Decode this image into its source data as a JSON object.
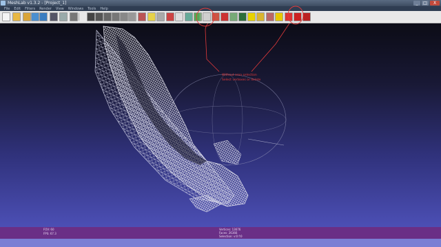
{
  "window": {
    "title": "MeshLab v1.3.2 - [Project_1]",
    "minimize_label": "_",
    "maximize_label": "□",
    "close_label": "X"
  },
  "menu": {
    "items": [
      "File",
      "Edit",
      "Filters",
      "Render",
      "View",
      "Windows",
      "Tools",
      "Help"
    ]
  },
  "toolbar": {
    "buttons": [
      {
        "icon": "new-file-icon",
        "color": "#f4f4f4"
      },
      {
        "icon": "open-folder-icon",
        "color": "#e8b844"
      },
      {
        "icon": "open-project-icon",
        "color": "#d9a53a"
      },
      {
        "icon": "reload-icon",
        "color": "#4a8fd0"
      },
      {
        "icon": "import-mesh-icon",
        "color": "#3a7dc0"
      },
      {
        "icon": "snapshot-icon",
        "color": "#556"
      },
      {
        "icon": "copy-icon",
        "color": "#9aa"
      },
      {
        "icon": "bounding-box-icon",
        "color": "#777"
      },
      {
        "icon": "points-icon",
        "color": "#444"
      },
      {
        "icon": "wireframe-icon",
        "color": "#555"
      },
      {
        "icon": "hidden-lines-icon",
        "color": "#666"
      },
      {
        "icon": "flat-lines-icon",
        "color": "#777"
      },
      {
        "icon": "flat-icon",
        "color": "#888"
      },
      {
        "icon": "smooth-icon",
        "color": "#999"
      },
      {
        "icon": "texture-icon",
        "color": "#b55"
      },
      {
        "icon": "light-icon",
        "color": "#e6d24a"
      },
      {
        "icon": "double-side-icon",
        "color": "#aaa"
      },
      {
        "icon": "fancy-light-icon",
        "color": "#c44"
      },
      {
        "icon": "back-face-icon",
        "color": "#ddd"
      },
      {
        "icon": "layer-icon",
        "color": "#6a9"
      },
      {
        "icon": "manipulator-icon",
        "color": "#5a5"
      },
      {
        "icon": "mesh-info-icon",
        "color": "#a33"
      },
      {
        "icon": "select-vertices-icon",
        "color": "#cfcfcf"
      },
      {
        "icon": "select-faces-icon",
        "color": "#c54"
      },
      {
        "icon": "select-connected-icon",
        "color": "#c33"
      },
      {
        "icon": "measure-icon",
        "color": "#7a7"
      },
      {
        "icon": "paint-icon",
        "color": "#2d6e3a"
      },
      {
        "icon": "annotation-icon",
        "color": "#e8d200"
      },
      {
        "icon": "pick-color-icon",
        "color": "#d9b530"
      },
      {
        "icon": "brush-icon",
        "color": "#b66"
      },
      {
        "icon": "info-icon",
        "color": "#e8c800"
      },
      {
        "icon": "delete-faces-icon",
        "color": "#d33"
      },
      {
        "icon": "delete-vertices-icon",
        "color": "#c22"
      },
      {
        "icon": "delete-selection-icon",
        "color": "#b22"
      }
    ]
  },
  "viewport": {
    "annotation_line1": "Without area selection",
    "annotation_line2": "Select vertexes or delete",
    "annotation_color": "#e53b3b"
  },
  "status": {
    "fov": "FOV: 60",
    "fps": "FPS:   67.3",
    "vertices": "Vertices: 13676",
    "faces": "Faces: 26366",
    "selection": "Selection: v:0 f:0"
  }
}
